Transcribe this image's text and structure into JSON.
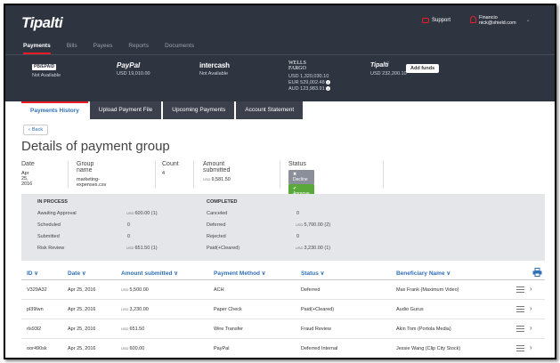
{
  "header": {
    "logo": "Tipalti",
    "support": "Support",
    "user_name": "Financio",
    "user_email": "nick@shield.com"
  },
  "nav": [
    "Payments",
    "Bills",
    "Payees",
    "Reports",
    "Documents"
  ],
  "balances": [
    {
      "name": "PB/EPAID",
      "value": "Not Available"
    },
    {
      "name": "PayPal",
      "value": "USD 19,010.00"
    },
    {
      "name": "intercash",
      "value": "Not Available"
    },
    {
      "name": "WELLS FARGO",
      "lines": [
        "USD 1,320,030.10",
        "EUR 529,002.48",
        "AUD 123,983.91"
      ]
    },
    {
      "name": "Tipalti",
      "value": "USD 232,200.10"
    }
  ],
  "add_funds": "Add funds",
  "tabs": [
    "Payments History",
    "Upload Payment File",
    "Upcoming Payments",
    "Account Statement"
  ],
  "back_label": "Back",
  "page_title": "Details of payment group",
  "summary": {
    "date_label": "Date",
    "date_value": "Apr 25, 2016",
    "group_label": "Group name",
    "group_value": "marketing-expenses.csv",
    "count_label": "Count",
    "count_value": "4",
    "amount_label": "Amount submitted",
    "amount_currency": "USD",
    "amount_value": "9,581.50",
    "status_label": "Status",
    "decline": "✖ Decline",
    "approve": "✔ Approve"
  },
  "in_process": {
    "title": "IN PROCESS",
    "rows": [
      {
        "label": "Awaiting Approval",
        "currency": "USD",
        "value": "600.00 (1)"
      },
      {
        "label": "Scheduled",
        "currency": "",
        "value": "0"
      },
      {
        "label": "Submitted",
        "currency": "",
        "value": "0"
      },
      {
        "label": "Risk Review",
        "currency": "USD",
        "value": "651.50 (1)"
      }
    ]
  },
  "completed": {
    "title": "COMPLETED",
    "rows": [
      {
        "label": "Canceled",
        "currency": "",
        "value": "0"
      },
      {
        "label": "Deferred",
        "currency": "USD",
        "value": "5,700.00 (2)"
      },
      {
        "label": "Rejected",
        "currency": "",
        "value": "0"
      },
      {
        "label": "Paid(+Cleared)",
        "currency": "USD",
        "value": "3,230.00 (1)"
      }
    ]
  },
  "table": {
    "columns": [
      "ID ∨",
      "Date ∨",
      "Amount submitted ∨",
      "Payment Method ∨",
      "Status ∨",
      "Beneficiary Name ∨"
    ],
    "rows": [
      {
        "id": "V329A32",
        "date": "Apr 25, 2016",
        "currency": "USD",
        "amount": "5,500.00",
        "method": "ACH",
        "status": "Deferred",
        "beneficiary": "Max Frank (Maximum Video)"
      },
      {
        "id": "pl39lwn",
        "date": "Apr 25, 2016",
        "currency": "USD",
        "amount": "3,230.00",
        "method": "Paper Check",
        "status": "Paid(+Cleared)",
        "beneficiary": "Audio Gurus"
      },
      {
        "id": "rls93l2",
        "date": "Apr 25, 2016",
        "currency": "USD",
        "amount": "651.50",
        "method": "Wire Transfer",
        "status": "Fraud Review",
        "beneficiary": "Akin Tom (Portola Media)"
      },
      {
        "id": "oor490sk",
        "date": "Apr 25, 2016",
        "currency": "USD",
        "amount": "600.00",
        "method": "PayPal",
        "status": "Deferred Internal",
        "beneficiary": "Jessie Wang (Clip City Stock)"
      }
    ]
  }
}
